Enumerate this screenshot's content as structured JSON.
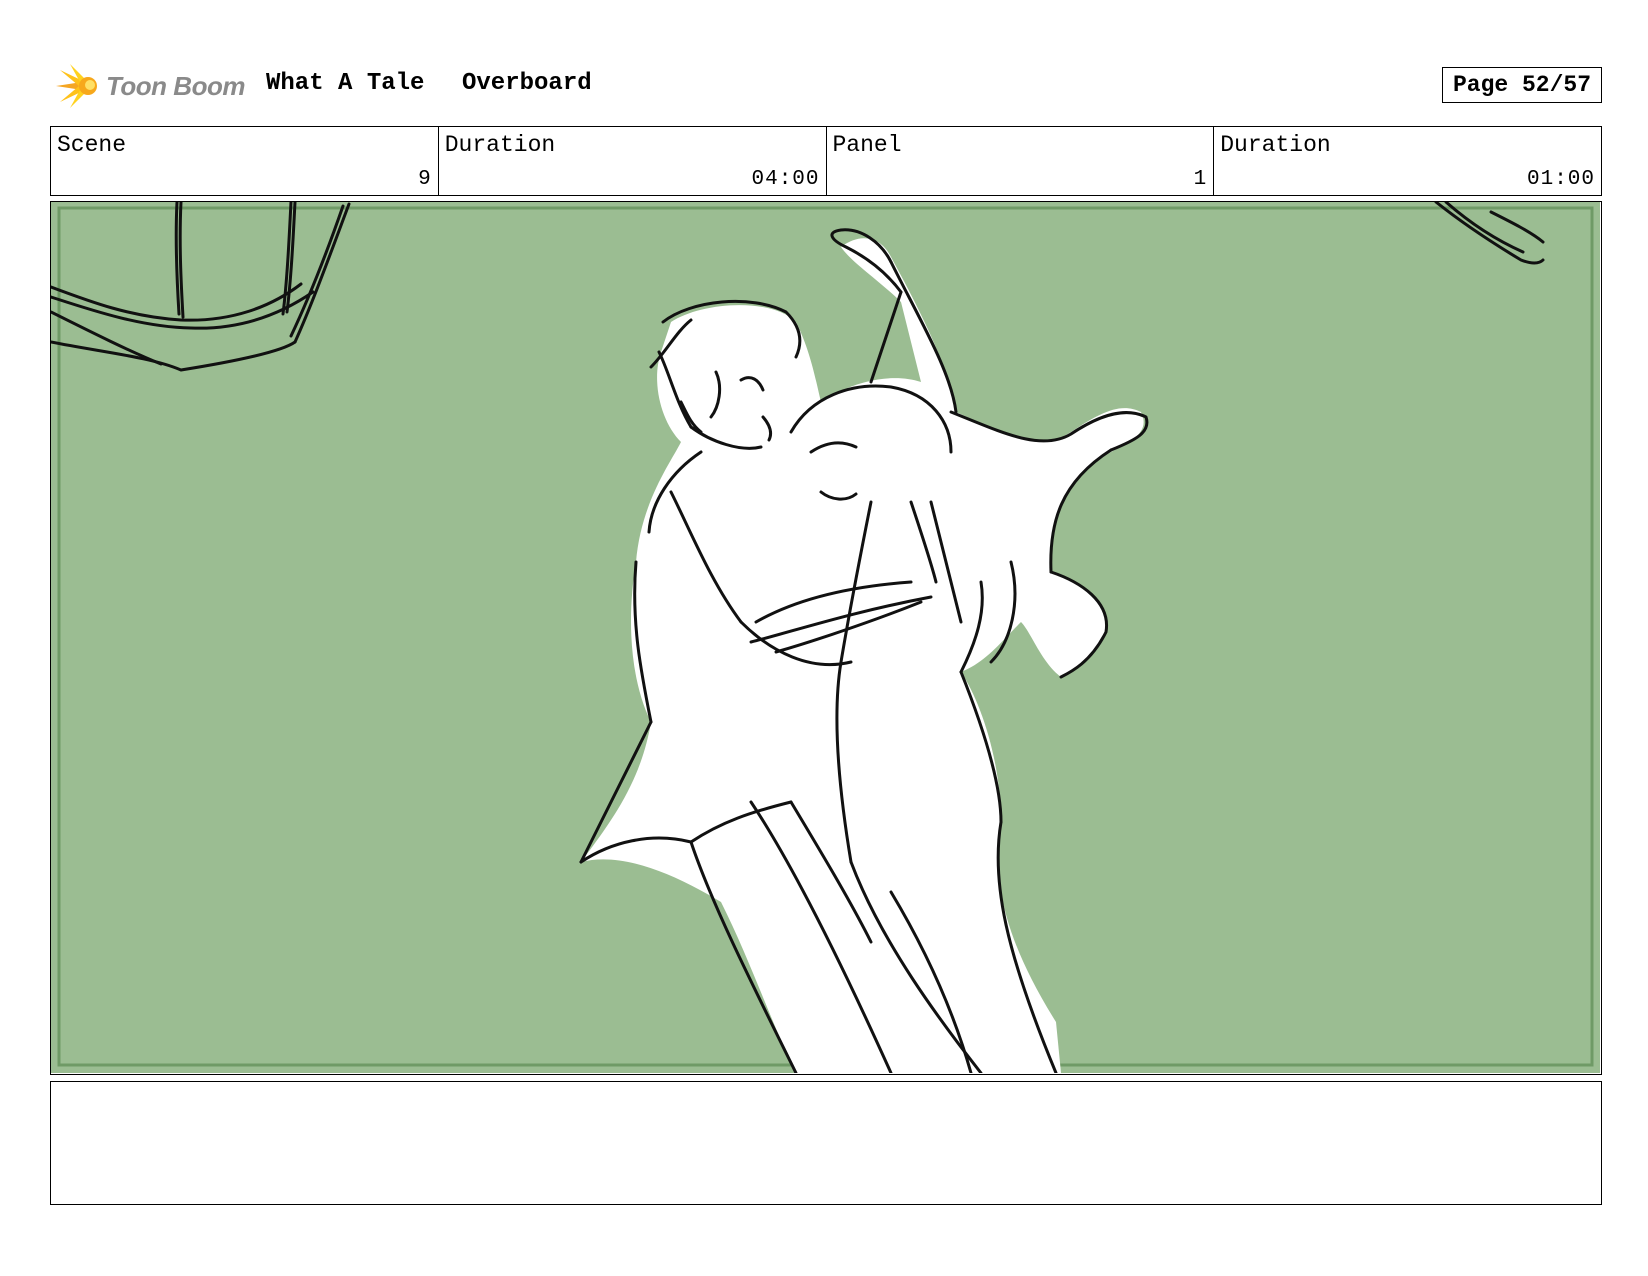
{
  "header": {
    "logo_text": "Toon Boom",
    "project_title": "What A Tale",
    "scene_title": "Overboard",
    "page_label": "Page 52/57"
  },
  "info": {
    "scene_label": "Scene",
    "scene_value": "9",
    "scene_duration_label": "Duration",
    "scene_duration_value": "04:00",
    "panel_label": "Panel",
    "panel_value": "1",
    "panel_duration_label": "Duration",
    "panel_duration_value": "01:00"
  },
  "panel": {
    "background_color": "#9bbd92",
    "inner_border_color": "#6f9a66",
    "description": ""
  },
  "colors": {
    "logo_orange": "#f5a623",
    "logo_yellow": "#ffd21f",
    "logo_text": "#8a8a8a"
  }
}
